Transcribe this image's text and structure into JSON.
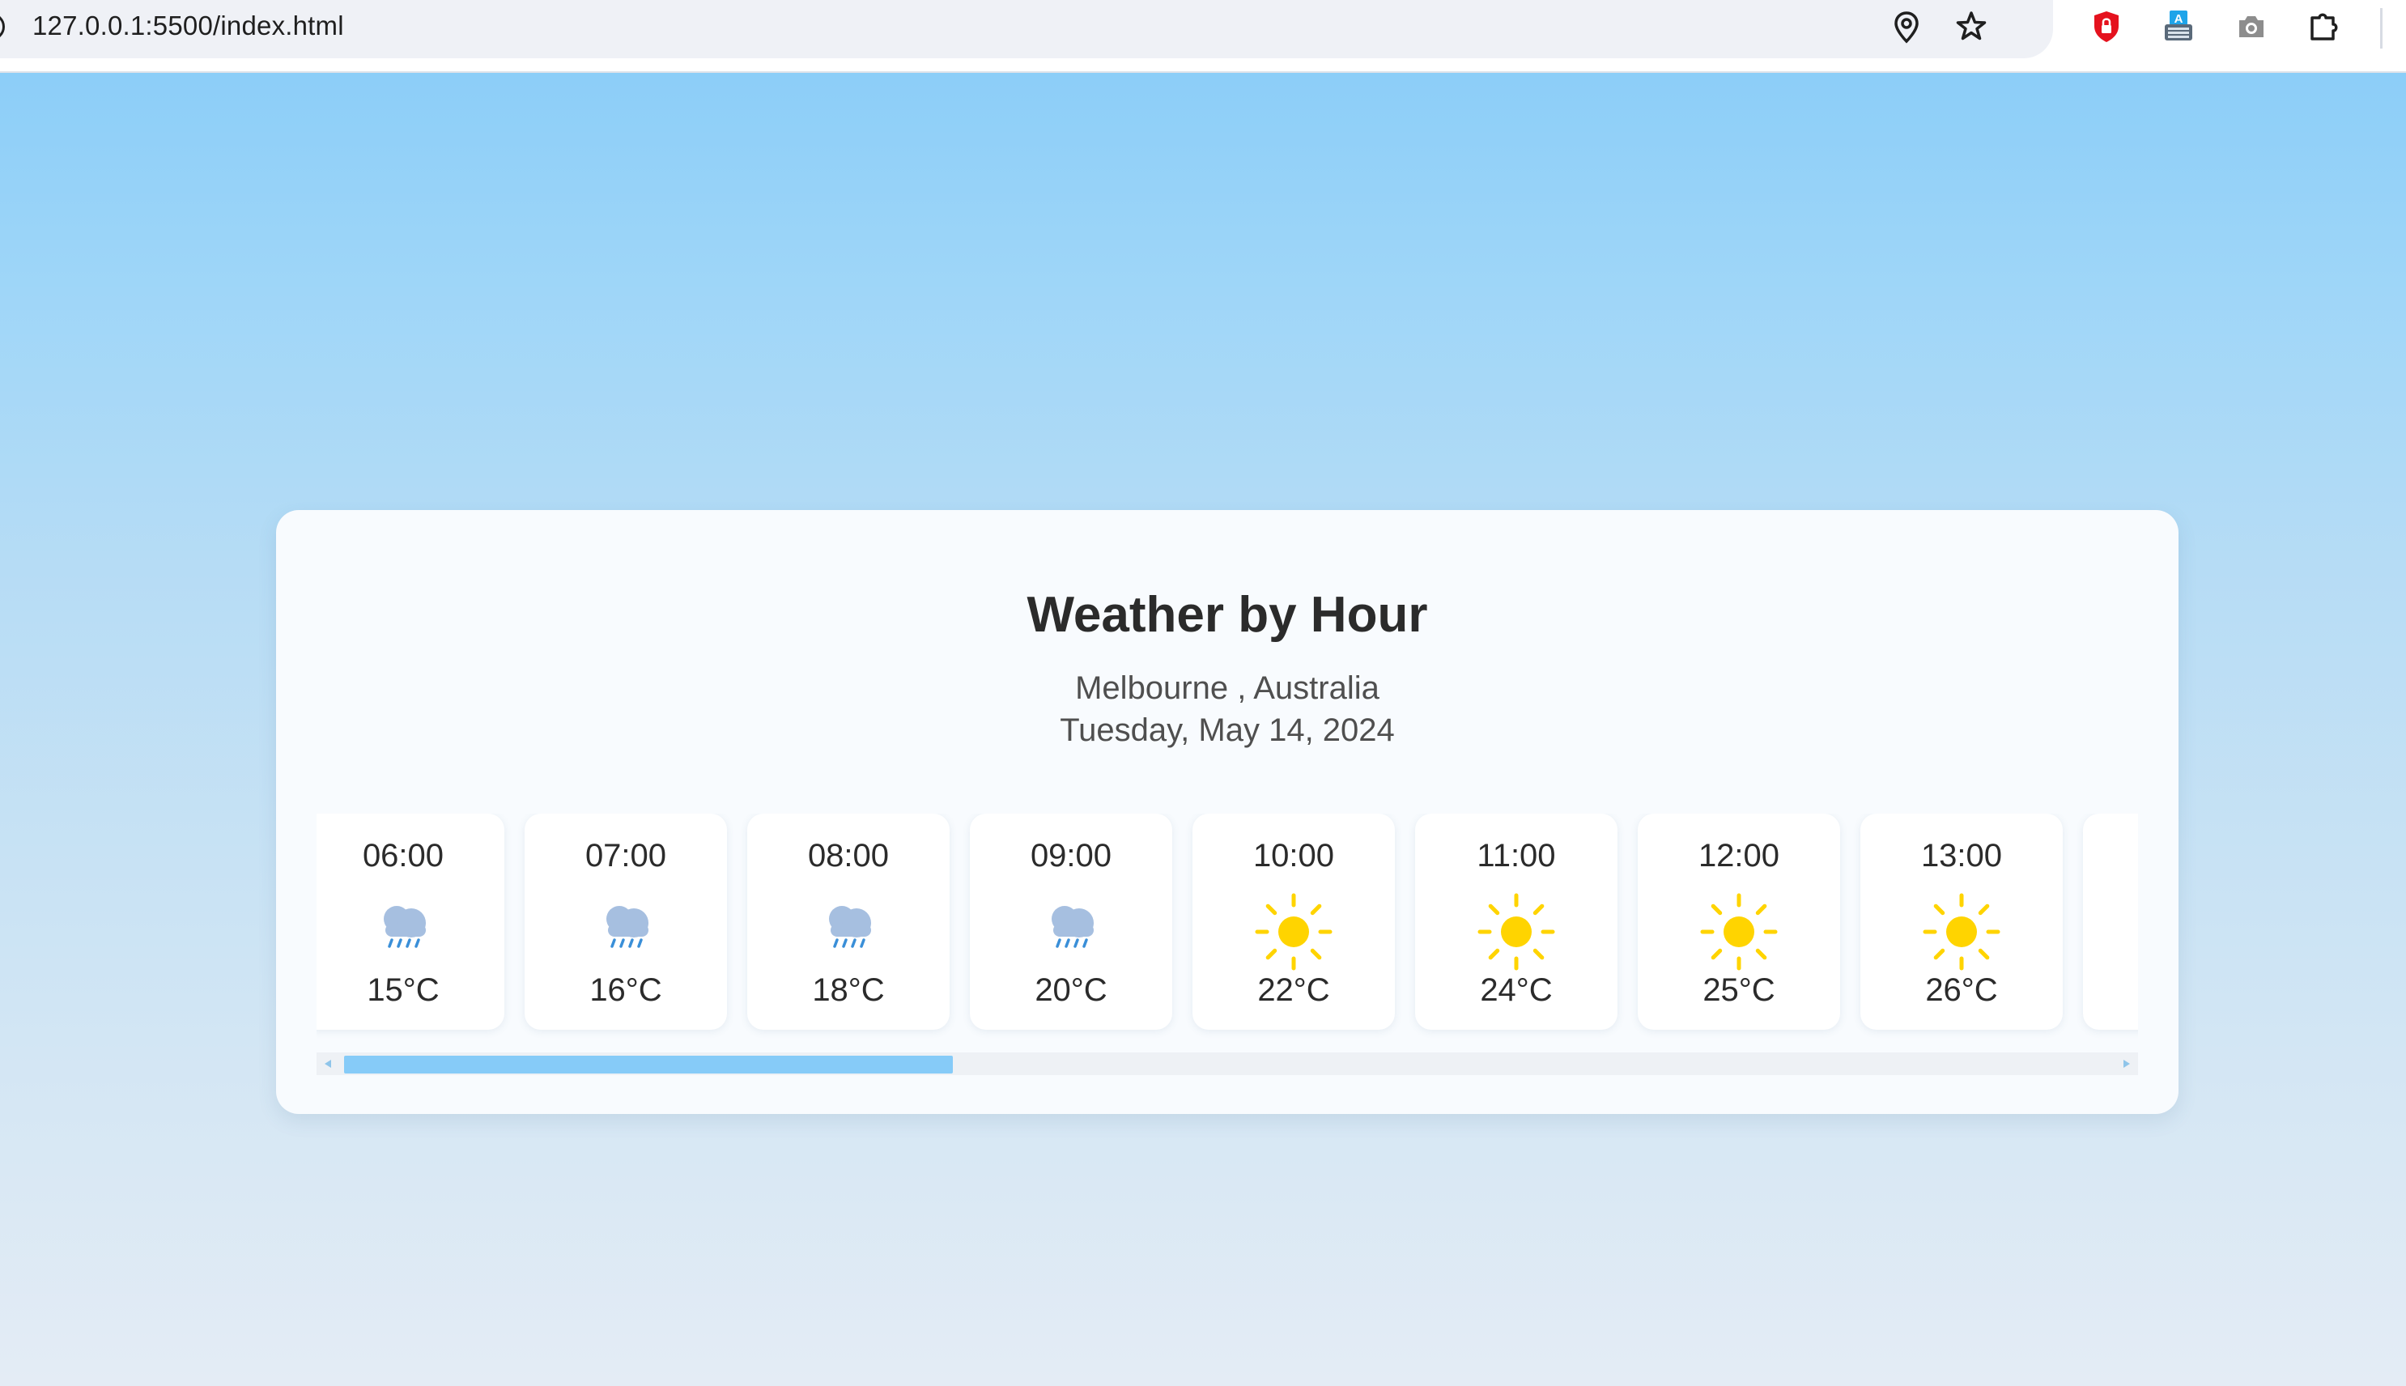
{
  "browser": {
    "url": "127.0.0.1:5500/index.html",
    "icons": [
      "info-icon",
      "location-pin-icon",
      "bookmark-star-icon",
      "shield-extension-icon",
      "translate-extension-icon",
      "camera-icon",
      "extensions-puzzle-icon"
    ]
  },
  "weather": {
    "title": "Weather by Hour",
    "location": "Melbourne , Australia",
    "date": "Tuesday, May 14, 2024",
    "hours": [
      {
        "time": "06:00",
        "icon": "rain-cloud-icon",
        "temp": "15°C"
      },
      {
        "time": "07:00",
        "icon": "rain-cloud-icon",
        "temp": "16°C"
      },
      {
        "time": "08:00",
        "icon": "rain-cloud-icon",
        "temp": "18°C"
      },
      {
        "time": "09:00",
        "icon": "rain-cloud-icon",
        "temp": "20°C"
      },
      {
        "time": "10:00",
        "icon": "sun-icon",
        "temp": "22°C"
      },
      {
        "time": "11:00",
        "icon": "sun-icon",
        "temp": "24°C"
      },
      {
        "time": "12:00",
        "icon": "sun-icon",
        "temp": "25°C"
      },
      {
        "time": "13:00",
        "icon": "sun-icon",
        "temp": "26°C"
      }
    ]
  },
  "scroll": {
    "position_fraction": 0.0
  },
  "colors": {
    "accent": "#86cbf8",
    "sun": "#ffd400",
    "cloud": "#a6bfe0",
    "rain": "#3a8fd8",
    "text": "#2b2b2b"
  }
}
